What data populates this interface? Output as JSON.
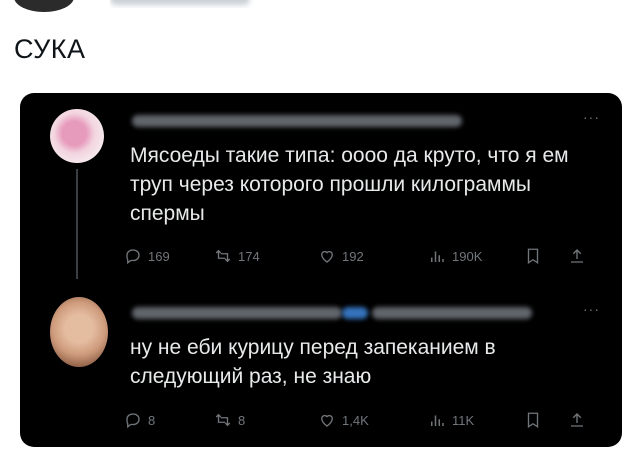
{
  "tweet": {
    "text": "СУКА"
  },
  "reply1": {
    "body": "Мясоеды такие типа: оооо да круто, что я ем труп через которого прошли килограммы спермы",
    "stats": {
      "replies": "169",
      "retweets": "174",
      "likes": "192",
      "views": "190K"
    }
  },
  "reply2": {
    "body": "ну не еби курицу перед запеканием в следующий раз, не знаю",
    "stats": {
      "replies": "8",
      "retweets": "8",
      "likes": "1,4K",
      "views": "11K"
    }
  },
  "colors": {
    "card_bg": "#000000",
    "text_primary": "#e7e9ea",
    "text_secondary": "#71767b",
    "page_bg": "#ffffff"
  },
  "icons": [
    "reply-icon",
    "retweet-icon",
    "like-icon",
    "views-icon",
    "bookmark-icon",
    "share-icon",
    "more-icon"
  ]
}
